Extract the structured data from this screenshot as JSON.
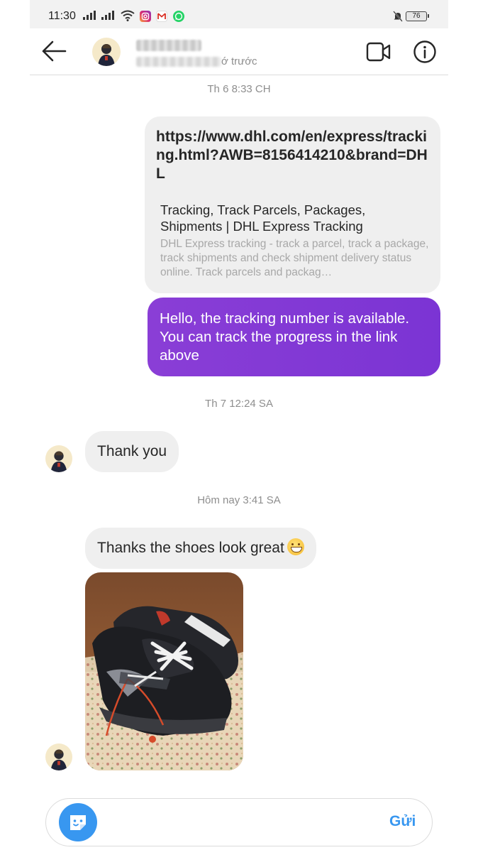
{
  "status_bar": {
    "time": "11:30",
    "battery": "76"
  },
  "header": {
    "status_suffix": "ớ trước"
  },
  "timestamps": {
    "t1": "Th 6 8:33 CH",
    "t2": "Th 7 12:24 SA",
    "t3": "Hôm nay 3:41 SA"
  },
  "messages": {
    "link_preview": {
      "url": "https://www.dhl.com/en/express/tracking.html?AWB=8156414210&brand=DHL",
      "title": "Tracking, Track Parcels, Packages, Shipments | DHL Express Tracking",
      "description": "DHL Express tracking - track a parcel, track a package, track shipments and check shipment delivery status online. Track parcels and packag…"
    },
    "sent_text": "Hello, the tracking number is available. You can track the progress in the link above",
    "thank_you": "Thank you",
    "shoes_text": "Thanks the shoes look great"
  },
  "composer": {
    "placeholder": "",
    "send_label": "Gửi"
  },
  "colors": {
    "sent_bubble": "#8a3ed6",
    "received_bubble": "#efefef",
    "accent": "#3897f0"
  }
}
